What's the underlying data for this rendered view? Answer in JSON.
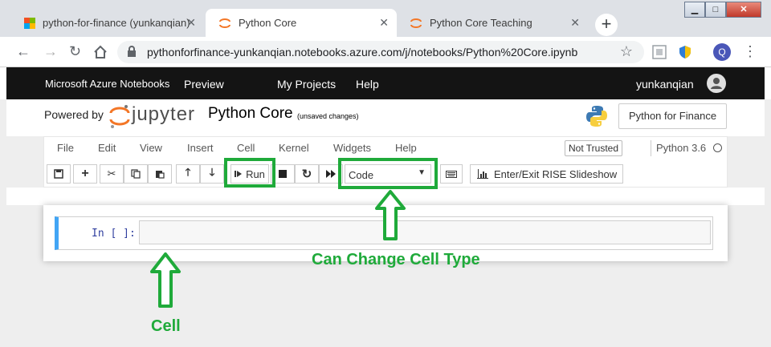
{
  "browser": {
    "tabs": [
      {
        "title": "python-for-finance (yunkanqian)",
        "favicon": "microsoft-logo"
      },
      {
        "title": "Python Core",
        "favicon": "jupyter-logo",
        "active": true
      },
      {
        "title": "Python Core Teaching",
        "favicon": "jupyter-logo"
      }
    ],
    "new_tab_label": "+",
    "url": "pythonforfinance-yunkanqian.notebooks.azure.com/j/notebooks/Python%20Core.ipynb",
    "profile_initial": "Q"
  },
  "azure_header": {
    "brand": "Microsoft Azure Notebooks",
    "preview": "Preview",
    "my_projects": "My Projects",
    "help": "Help",
    "username": "yunkanqian"
  },
  "jupyter_header": {
    "powered_by": "Powered by",
    "logo_text": "jupyter",
    "notebook_title": "Python Core",
    "save_status": "(unsaved changes)",
    "project_button": "Python for Finance"
  },
  "menubar": {
    "items": [
      "File",
      "Edit",
      "View",
      "Insert",
      "Cell",
      "Kernel",
      "Widgets",
      "Help"
    ],
    "trust_status": "Not Trusted",
    "kernel_name": "Python 3.6"
  },
  "toolbar": {
    "run_label": "Run",
    "cell_type": "Code",
    "rise_label": "Enter/Exit RISE Slideshow"
  },
  "cell": {
    "prompt": "In [ ]:",
    "input": ""
  },
  "annotations": {
    "cell_type_label": "Can Change Cell Type",
    "cell_label": "Cell",
    "color": "#1faa3a"
  }
}
